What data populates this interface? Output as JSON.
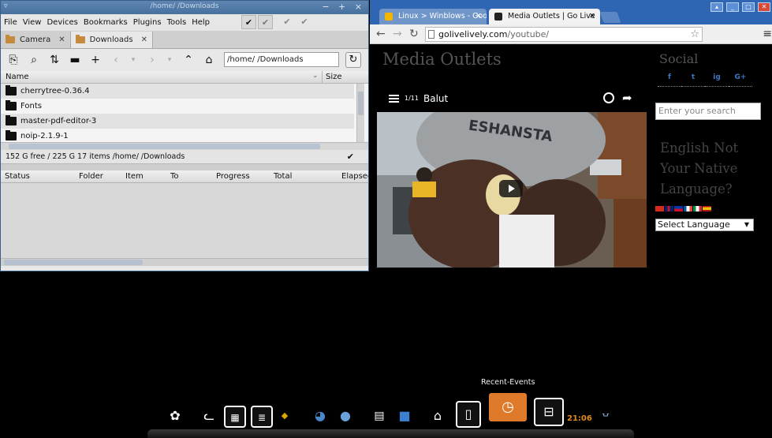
{
  "file_manager": {
    "title": "/home/        /Downloads",
    "menu": [
      "File",
      "View",
      "Devices",
      "Bookmarks",
      "Plugins",
      "Tools",
      "Help"
    ],
    "tabs": [
      {
        "label": "Camera"
      },
      {
        "label": "Downloads"
      }
    ],
    "path": "/home/          /Downloads",
    "columns": {
      "name": "Name",
      "size": "Size"
    },
    "files": [
      "cherrytree-0.36.4",
      "Fonts",
      "master-pdf-editor-3",
      "noip-2.1.9-1"
    ],
    "status": "152 G free / 225 G   17 items   /home/         /Downloads",
    "queue_columns": [
      "Status",
      "Folder",
      "Item",
      "To",
      "Progress",
      "Total",
      "Elapsed"
    ]
  },
  "browser": {
    "tabs": [
      {
        "label": "Linux > Winblows - Goo",
        "favicon_color": "#f2b600"
      },
      {
        "label": "Media Outlets | Go Live",
        "favicon_color": "#222222"
      }
    ],
    "url_host": "golivelively.com",
    "url_path": "/youtube/",
    "page_title": "Media Outlets",
    "playlist_count": "1/11",
    "video_title": "Balut",
    "sidebar": {
      "social_heading": "Social",
      "social_icons": [
        "f",
        "t",
        "ig",
        "G+"
      ],
      "search_placeholder": "Enter your search",
      "english_heading": [
        "English Not",
        "Your Native",
        "Language?"
      ],
      "language_select": "Select Language"
    }
  },
  "dock": {
    "tooltip": "Recent-Events",
    "clock": "21:06"
  }
}
